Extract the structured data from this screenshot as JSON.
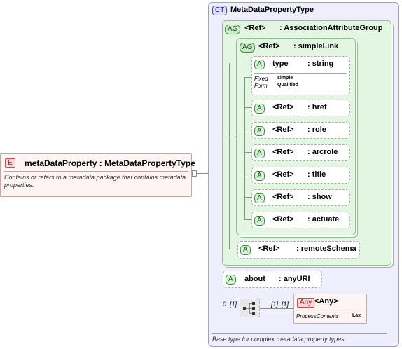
{
  "element": {
    "tag": "E",
    "name": "metaDataProperty",
    "separator": ":",
    "type": "MetaDataPropertyType",
    "doc": "Contains or refers to a metadata package that contains metadata properties."
  },
  "complex_type": {
    "tag": "CT",
    "name": "MetaDataPropertyType",
    "doc": "Base type for complex metadata property types."
  },
  "outer_group": {
    "tag": "AG",
    "ref": "<Ref>",
    "name": ": AssociationAttributeGroup"
  },
  "inner_group": {
    "tag": "AG",
    "ref": "<Ref>",
    "name": ": simpleLink"
  },
  "type_attr": {
    "tag": "A",
    "name": "type",
    "type": ": string",
    "fixed_label": "Fixed",
    "fixed_value": "simple",
    "form_label": "Form",
    "form_value": "Qualified"
  },
  "link_attrs": [
    {
      "tag": "A",
      "ref": "<Ref>",
      "name": ": href"
    },
    {
      "tag": "A",
      "ref": "<Ref>",
      "name": ": role"
    },
    {
      "tag": "A",
      "ref": "<Ref>",
      "name": ": arcrole"
    },
    {
      "tag": "A",
      "ref": "<Ref>",
      "name": ": title"
    },
    {
      "tag": "A",
      "ref": "<Ref>",
      "name": ": show"
    },
    {
      "tag": "A",
      "ref": "<Ref>",
      "name": ": actuate"
    }
  ],
  "remote_schema": {
    "tag": "A",
    "ref": "<Ref>",
    "name": ": remoteSchema"
  },
  "about_attr": {
    "tag": "A",
    "name": "about",
    "type": ": anyURI"
  },
  "sequence": {
    "min_label": "0..[1]",
    "max_label": "[1]..[1]"
  },
  "any_elem": {
    "tag": "Any",
    "name": "<Any>",
    "pc_label": "ProcessContents",
    "pc_value": "Lax"
  }
}
